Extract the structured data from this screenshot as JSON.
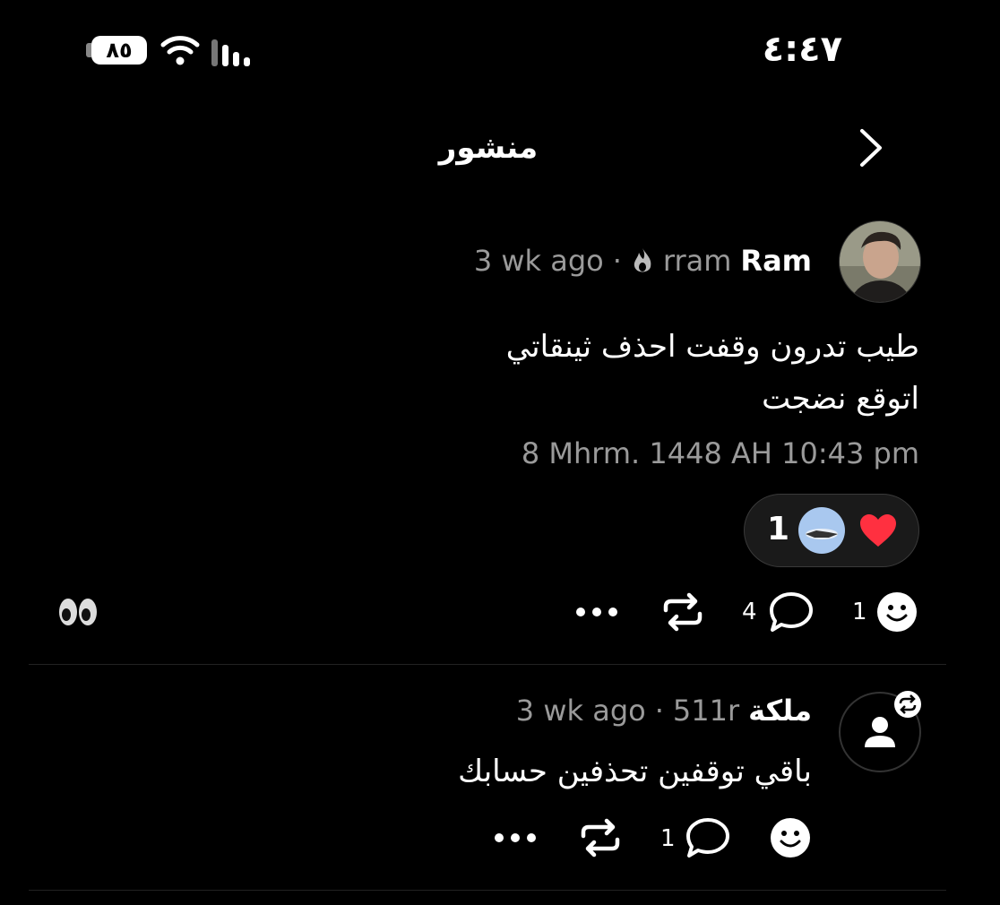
{
  "status_bar": {
    "time": "٤:٤٧",
    "battery": "٨٥"
  },
  "header": {
    "title": "منشور"
  },
  "post": {
    "author_name": "Ram",
    "author_handle": "rram",
    "time_ago": "3 wk ago",
    "separator": "·",
    "text_line1": "طيب تدرون وقفت احذف ثينقاتي",
    "text_line2": "اتوقع نضجت",
    "date": "8 Mhrm. 1448 AH 10:43 pm",
    "reaction_count": "1",
    "comment_count": "4",
    "emoji_count": "1"
  },
  "reply": {
    "author_name": "ملكة",
    "author_handle": "511r",
    "time_ago": "3 wk ago",
    "separator": "·",
    "text": "باقي توقفين تحذفين حسابك",
    "comment_count": "1"
  },
  "colors": {
    "background": "#000000",
    "muted_text": "#9a9a9a",
    "heart": "#ff3040"
  },
  "icons": [
    "battery-icon",
    "wifi-icon",
    "signal-icon",
    "back-chevron-icon",
    "flame-icon",
    "heart-icon",
    "eyes-icon",
    "emoji-icon",
    "comment-icon",
    "repost-icon",
    "more-icon",
    "person-icon",
    "repost-badge-icon"
  ]
}
